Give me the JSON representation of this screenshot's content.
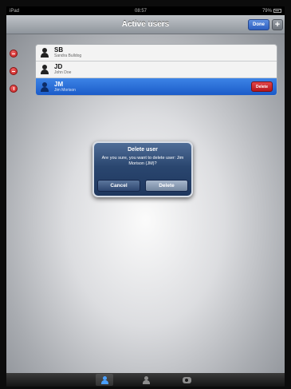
{
  "status_bar": {
    "device": "iPad",
    "time": "08:57",
    "battery": "79%"
  },
  "nav": {
    "title": "Active users",
    "done_label": "Done",
    "add_label": "+"
  },
  "users": [
    {
      "initials": "SB",
      "name": "Sandra Bulldog"
    },
    {
      "initials": "JD",
      "name": "John Doe"
    },
    {
      "initials": "JM",
      "name": "Jim Morison",
      "delete_label": "Delete"
    }
  ],
  "dialog": {
    "title": "Delete user",
    "message": "Are you sure, you want to delete user: Jim Morison  (JM)?",
    "cancel_label": "Cancel",
    "delete_label": "Delete"
  },
  "tab_bar": {
    "tabs": [
      "users-icon",
      "user-icon",
      "gear-icon"
    ],
    "active": 0
  },
  "colors": {
    "accent": "#2d5fc0",
    "danger": "#c41c1c",
    "selected_row": "#1b5bc9"
  }
}
